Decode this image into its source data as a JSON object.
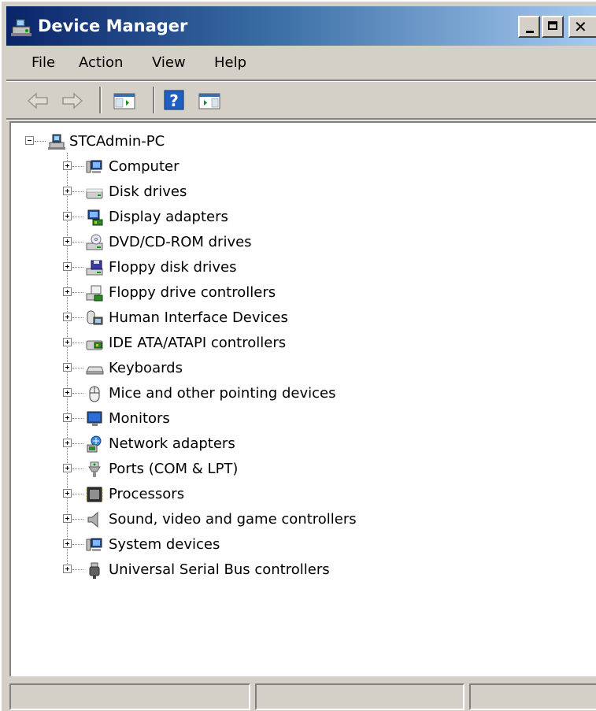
{
  "window": {
    "title": "Device Manager",
    "title_icon": "device-manager-icon",
    "colors": {
      "title_start": "#0a246a",
      "title_end": "#a6caf0",
      "chrome": "#d4d0c8",
      "panel": "#ffffff"
    }
  },
  "menubar": {
    "items": [
      {
        "label": "File"
      },
      {
        "label": "Action"
      },
      {
        "label": "View"
      },
      {
        "label": "Help"
      }
    ]
  },
  "toolbar": {
    "buttons": [
      {
        "name": "back",
        "icon": "back-arrow-icon",
        "enabled": false
      },
      {
        "name": "forward",
        "icon": "forward-arrow-icon",
        "enabled": false
      },
      {
        "name": "show-hide-console-tree",
        "icon": "console-tree-icon"
      },
      {
        "name": "help",
        "icon": "help-icon"
      },
      {
        "name": "show-hide-action-pane",
        "icon": "action-pane-icon"
      }
    ]
  },
  "tree": {
    "root": {
      "label": "STCAdmin-PC",
      "icon": "computer-network-icon",
      "expanded": true
    },
    "categories": [
      {
        "label": "Computer",
        "icon": "computer-icon"
      },
      {
        "label": "Disk drives",
        "icon": "disk-drive-icon"
      },
      {
        "label": "Display adapters",
        "icon": "display-adapter-icon"
      },
      {
        "label": "DVD/CD-ROM drives",
        "icon": "dvd-drive-icon"
      },
      {
        "label": "Floppy disk drives",
        "icon": "floppy-drive-icon"
      },
      {
        "label": "Floppy drive controllers",
        "icon": "floppy-controller-icon"
      },
      {
        "label": "Human Interface Devices",
        "icon": "hid-icon"
      },
      {
        "label": "IDE ATA/ATAPI controllers",
        "icon": "ide-controller-icon"
      },
      {
        "label": "Keyboards",
        "icon": "keyboard-icon"
      },
      {
        "label": "Mice and other pointing devices",
        "icon": "mouse-icon"
      },
      {
        "label": "Monitors",
        "icon": "monitor-icon"
      },
      {
        "label": "Network adapters",
        "icon": "network-adapter-icon"
      },
      {
        "label": "Ports (COM & LPT)",
        "icon": "port-icon"
      },
      {
        "label": "Processors",
        "icon": "processor-icon"
      },
      {
        "label": "Sound, video and game controllers",
        "icon": "sound-icon"
      },
      {
        "label": "System devices",
        "icon": "system-device-icon"
      },
      {
        "label": "Universal Serial Bus controllers",
        "icon": "usb-icon"
      }
    ]
  },
  "statusbar": {
    "panes": [
      {
        "text": ""
      },
      {
        "text": ""
      },
      {
        "text": ""
      }
    ]
  }
}
